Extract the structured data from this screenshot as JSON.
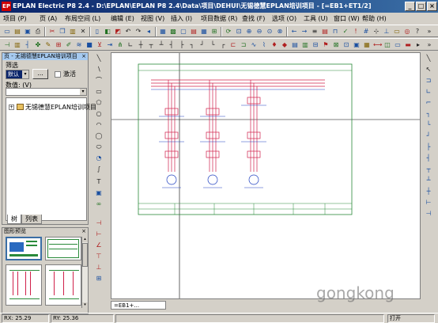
{
  "window": {
    "title": "EPLAN Electric P8 2.4 - D:\\EPLAN\\EPLAN P8 2.4\\Data\\项目\\DEHUI\\无锡德慧EPLAN培训项目 - [=EB1+ET1/2]",
    "app_icon": "EP"
  },
  "menu": [
    "项目 (P)",
    "页 (A)",
    "布局空间 (L)",
    "编辑 (E)",
    "视图 (V)",
    "插入 (I)",
    "项目数据 (R)",
    "查找 (F)",
    "选项 (O)",
    "工具 (U)",
    "窗口 (W)",
    "帮助 (H)"
  ],
  "page_nav": {
    "title": "页 - 无锡德慧EPLAN培训项目",
    "filter_label": "筛选",
    "filter_value": "默认",
    "filter_more": "...",
    "active_label": "激活",
    "value_label": "数值: (V)",
    "tree_item": "无锡德慧EPLAN培训项目",
    "tab_tree": "树",
    "tab_list": "列表"
  },
  "preview": {
    "title": "图形预览"
  },
  "document_tab": "=EB1+...",
  "status": {
    "rx": "RX: 25.29",
    "ry": "RY: 25.36",
    "mode": "打开"
  },
  "watermark": "gongkong",
  "colors": {
    "titlebar_start": "#0a246a",
    "titlebar_end": "#3a6ea5",
    "schematic_line": "#d0204a",
    "schematic_blue": "#2040c0",
    "frame_green": "#2a8a3a"
  },
  "icons": {
    "toolbar1": [
      "new-icon",
      "open-icon",
      "save-icon",
      "print-icon",
      "cut-icon",
      "copy-icon",
      "paste-icon",
      "undo-icon",
      "redo-icon",
      "zoom-icon",
      "grid-icon",
      "layer-icon"
    ],
    "vertical_tools": [
      "pointer-icon",
      "line-icon",
      "polyline-icon",
      "rectangle-icon",
      "circle-icon",
      "arc-icon",
      "ellipse-icon",
      "spline-icon",
      "text-icon",
      "image-icon",
      "dimension-icon"
    ]
  }
}
